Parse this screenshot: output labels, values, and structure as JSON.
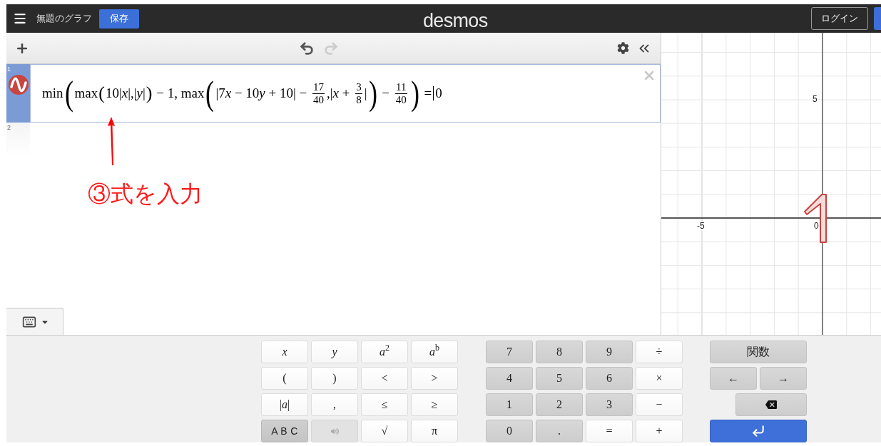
{
  "topbar": {
    "title": "無題のグラフ",
    "save": "保存",
    "logo": "desmos",
    "login": "ログイン"
  },
  "toolbar": {
    "undo": {
      "disabled": false
    },
    "redo": {
      "disabled": true
    }
  },
  "expressions": [
    {
      "number": "1",
      "selected": true,
      "tokens": [
        {
          "kind": "text",
          "text": "min"
        },
        {
          "kind": "bigparen",
          "text": "("
        },
        {
          "kind": "text",
          "text": "max"
        },
        {
          "kind": "paren",
          "text": "("
        },
        {
          "kind": "text",
          "text": "10|*x*|,|*y*|"
        },
        {
          "kind": "paren",
          "text": ")"
        },
        {
          "kind": "text",
          "text": " − 1, max"
        },
        {
          "kind": "bigparen",
          "text": "("
        },
        {
          "kind": "text",
          "text": "|7"
        },
        {
          "kind": "var",
          "text": "x"
        },
        {
          "kind": "text",
          "text": " − 10"
        },
        {
          "kind": "var",
          "text": "y"
        },
        {
          "kind": "text",
          "text": " + 10| − "
        },
        {
          "kind": "frac",
          "num": "17",
          "den": "40"
        },
        {
          "kind": "text",
          "text": ",|*x* + "
        },
        {
          "kind": "frac",
          "num": "3",
          "den": "8"
        },
        {
          "kind": "text",
          "text": "|"
        },
        {
          "kind": "bigparen",
          "text": ")"
        },
        {
          "kind": "text",
          "text": " − "
        },
        {
          "kind": "frac",
          "num": "11",
          "den": "40"
        },
        {
          "kind": "bigparen",
          "text": ")"
        },
        {
          "kind": "text",
          "text": " ="
        },
        {
          "kind": "cursor"
        },
        {
          "kind": "text",
          "text": "0"
        }
      ]
    },
    {
      "number": "2",
      "selected": false
    }
  ],
  "keyboard_toggle": {
    "expanded": true
  },
  "annotation": {
    "text": "③式を入力"
  },
  "graph": {
    "labels": [
      {
        "kind": "y",
        "text": "5"
      },
      {
        "kind": "x",
        "text": "-5"
      },
      {
        "kind": "origin",
        "text": "0"
      }
    ]
  },
  "keypad": {
    "groups": [
      [
        [
          {
            "kind": "white",
            "label": "*x*"
          },
          {
            "kind": "white",
            "label": "*y*"
          },
          {
            "kind": "white",
            "label": "*a*$^{2}$"
          },
          {
            "kind": "white",
            "label": "*a*$^{b}$"
          }
        ],
        [
          {
            "kind": "white",
            "label": "("
          },
          {
            "kind": "white",
            "label": ")"
          },
          {
            "kind": "white",
            "label": "<"
          },
          {
            "kind": "white",
            "label": ">"
          }
        ],
        [
          {
            "kind": "white",
            "label": "|*a*|"
          },
          {
            "kind": "white",
            "label": ","
          },
          {
            "kind": "white",
            "label": "≤"
          },
          {
            "kind": "white",
            "label": "≥"
          }
        ],
        [
          {
            "kind": "dark",
            "label": "A B C"
          },
          {
            "kind": "speaker"
          },
          {
            "kind": "white",
            "label": "√"
          },
          {
            "kind": "white",
            "label": "π"
          }
        ]
      ],
      [
        [
          {
            "kind": "gray",
            "label": "7"
          },
          {
            "kind": "gray",
            "label": "8"
          },
          {
            "kind": "gray",
            "label": "9"
          },
          {
            "kind": "white",
            "label": "÷"
          }
        ],
        [
          {
            "kind": "gray",
            "label": "4"
          },
          {
            "kind": "gray",
            "label": "5"
          },
          {
            "kind": "gray",
            "label": "6"
          },
          {
            "kind": "white",
            "label": "×"
          }
        ],
        [
          {
            "kind": "gray",
            "label": "1"
          },
          {
            "kind": "gray",
            "label": "2"
          },
          {
            "kind": "gray",
            "label": "3"
          },
          {
            "kind": "white",
            "label": "−"
          }
        ],
        [
          {
            "kind": "gray",
            "label": "0"
          },
          {
            "kind": "gray",
            "label": "."
          },
          {
            "kind": "white",
            "label": "="
          },
          {
            "kind": "white",
            "label": "+"
          }
        ]
      ],
      [
        [
          {
            "kind": "gray",
            "label": "関数"
          }
        ],
        [
          {
            "kind": "gray",
            "label": "←"
          },
          {
            "kind": "gray",
            "label": "→"
          }
        ],
        [
          {
            "kind": "erase"
          }
        ],
        [
          {
            "kind": "enter"
          }
        ]
      ]
    ]
  }
}
